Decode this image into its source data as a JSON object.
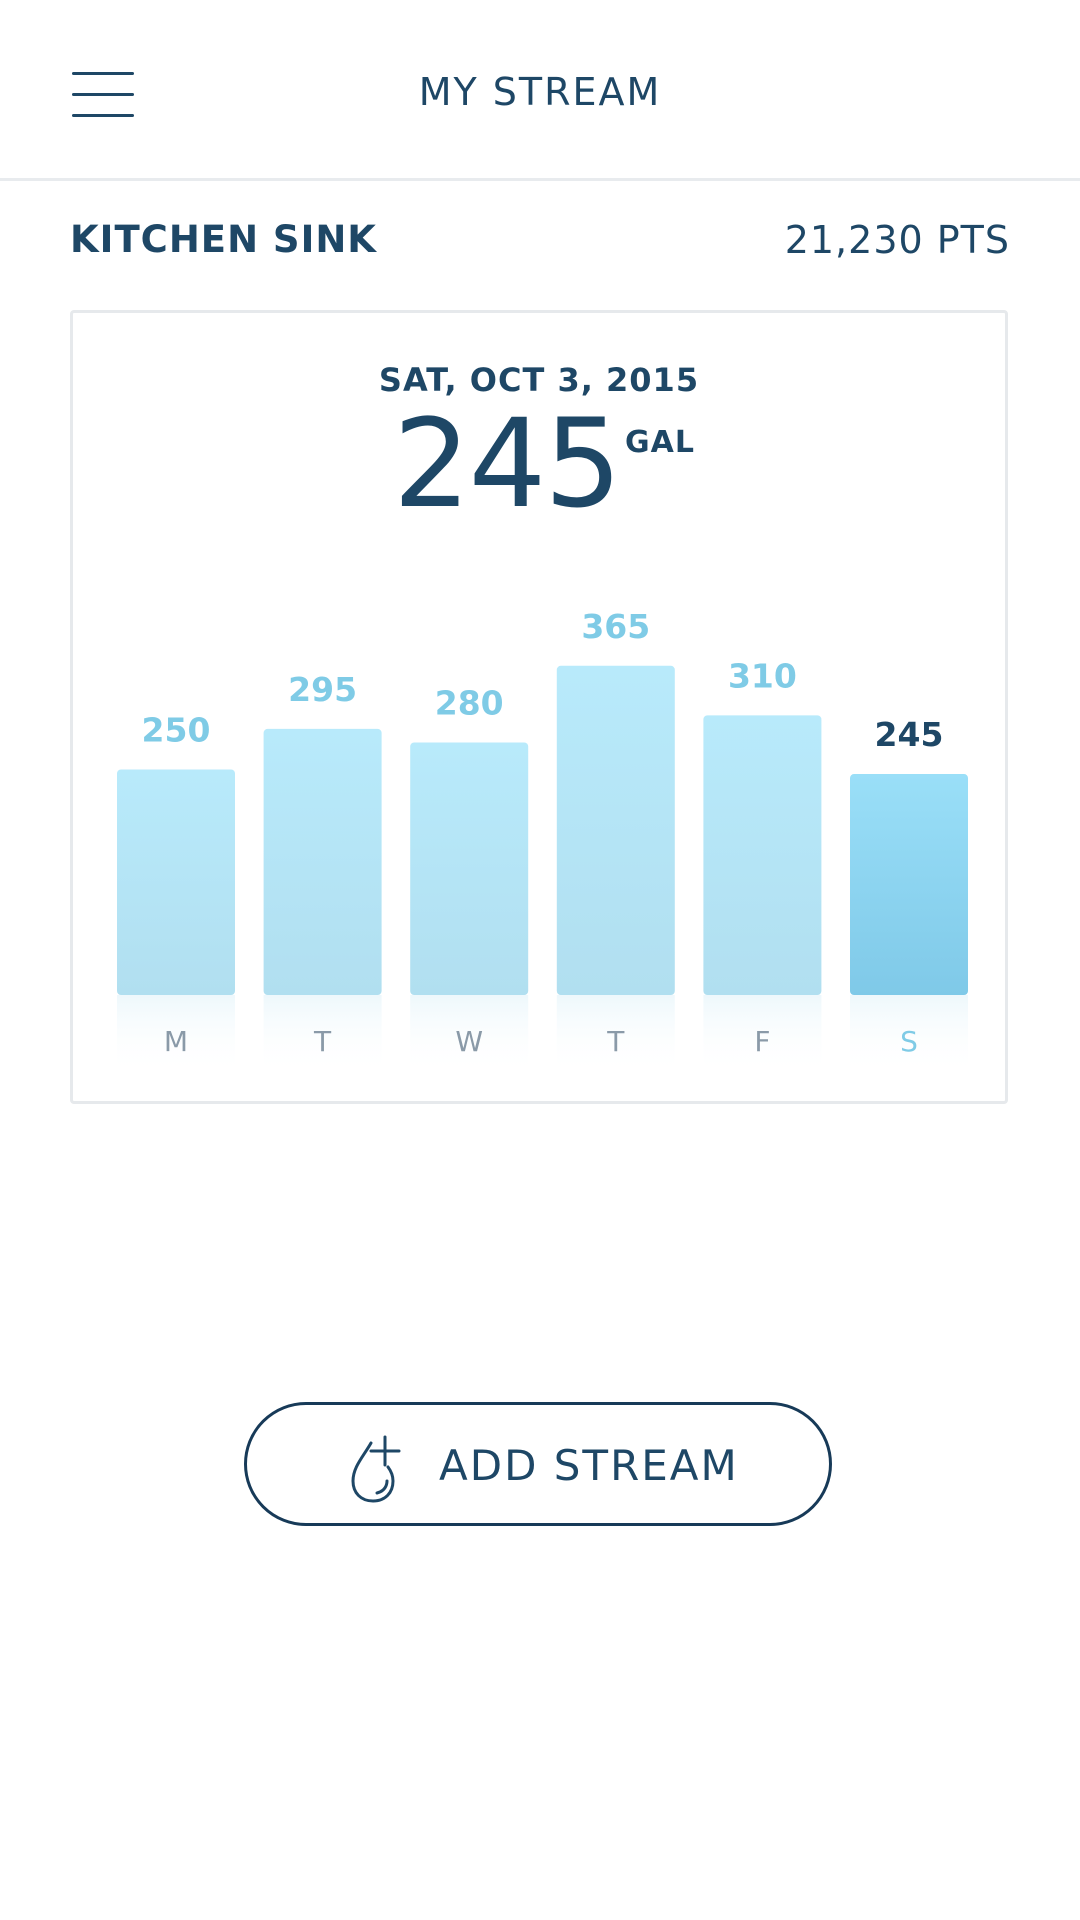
{
  "header": {
    "title": "MY STREAM",
    "menu_icon": "hamburger-menu-icon"
  },
  "stream": {
    "name": "KITCHEN SINK",
    "points": "21,230 PTS"
  },
  "selected": {
    "date": "SAT, OCT 3, 2015",
    "value": "245",
    "unit": "GAL"
  },
  "colors": {
    "text": "#1e4766",
    "bar": "#b3e6f7",
    "bar_selected": "#86cde9",
    "bar_label": "#7fcbe6",
    "day_label": "#8a9aa8"
  },
  "chart_data": {
    "type": "bar",
    "categories": [
      "M",
      "T",
      "W",
      "T",
      "F",
      "S"
    ],
    "values": [
      250,
      295,
      280,
      365,
      310,
      245
    ],
    "value_labels": [
      "250",
      "295",
      "280",
      "365",
      "310",
      "245"
    ],
    "selected_index": 5,
    "ylim": [
      0,
      365
    ],
    "grid": false
  },
  "actions": {
    "add_stream_label": "ADD STREAM",
    "add_stream_icon": "water-drop-plus-icon"
  }
}
